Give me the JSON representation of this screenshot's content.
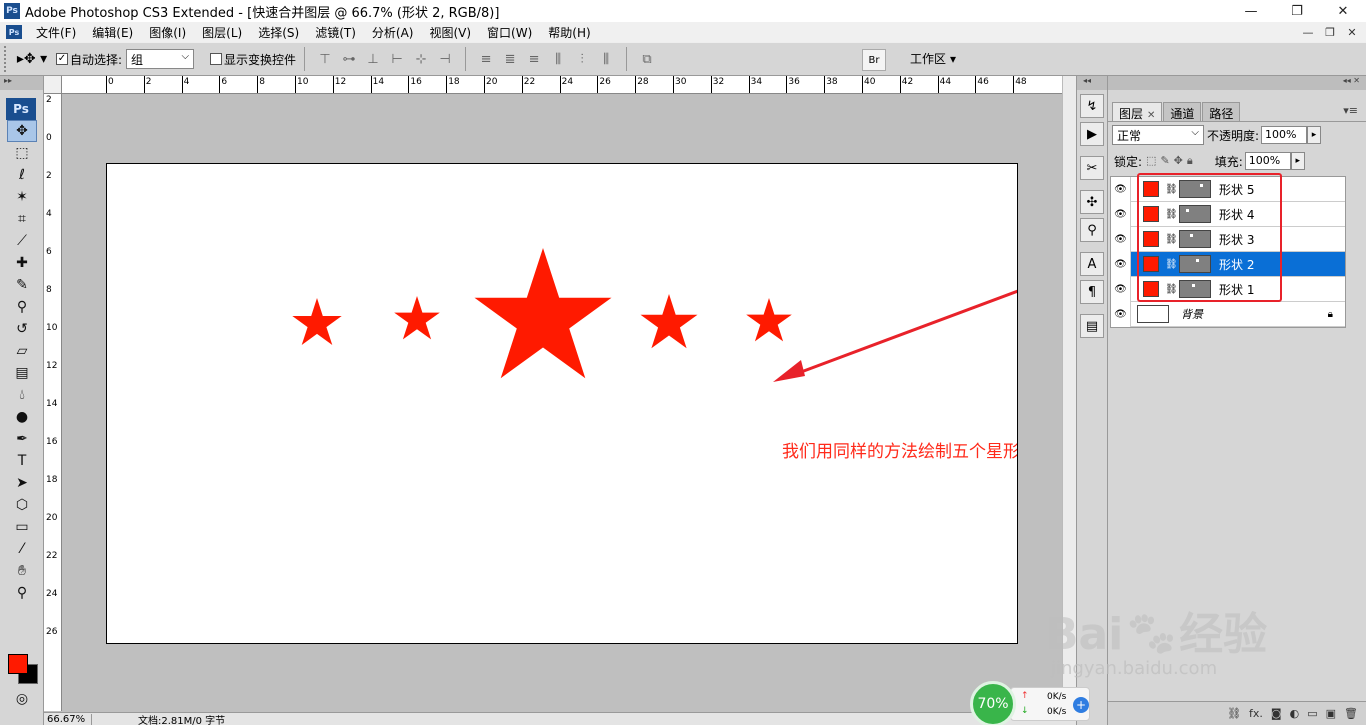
{
  "window": {
    "title": "Adobe Photoshop CS3 Extended - [快速合并图层 @ 66.7% (形状 2, RGB/8)]",
    "app_icon": "Ps",
    "controls": [
      "—",
      "❐",
      "✕"
    ]
  },
  "menu": {
    "items": [
      "文件(F)",
      "编辑(E)",
      "图像(I)",
      "图层(L)",
      "选择(S)",
      "滤镜(T)",
      "分析(A)",
      "视图(V)",
      "窗口(W)",
      "帮助(H)"
    ],
    "doc_controls": [
      "—",
      "❐",
      "✕"
    ]
  },
  "options": {
    "auto_select_label": "自动选择:",
    "auto_select_value": "组",
    "show_transform_label": "显示变换控件",
    "workspace_label": "工作区",
    "bridge_label": "Br"
  },
  "toolbox": {
    "badge": "Ps",
    "tools": [
      "move-tool",
      "marquee-tool",
      "lasso-tool",
      "magic-wand-tool",
      "crop-tool",
      "slice-tool",
      "healing-brush-tool",
      "brush-tool",
      "clone-stamp-tool",
      "history-brush-tool",
      "eraser-tool",
      "gradient-tool",
      "blur-tool",
      "dodge-tool",
      "pen-tool",
      "type-tool",
      "path-select-tool",
      "shape-tool",
      "notes-tool",
      "eyedropper-tool",
      "hand-tool",
      "zoom-tool"
    ],
    "fg_color": "#ff1a00",
    "bg_color": "#000000"
  },
  "rulers": {
    "h": [
      "0",
      "2",
      "4",
      "6",
      "8",
      "10",
      "12",
      "14",
      "16",
      "18",
      "20",
      "22",
      "24",
      "26",
      "28",
      "30",
      "32",
      "34",
      "36",
      "38",
      "40",
      "42",
      "44",
      "46",
      "48"
    ],
    "v": [
      "2",
      "0",
      "2",
      "4",
      "6",
      "8",
      "10",
      "12",
      "14",
      "16",
      "18",
      "20",
      "22",
      "24",
      "26"
    ]
  },
  "canvas": {
    "star_color": "#ff1a00",
    "star_count": 5,
    "annotation": "我们用同样的方法绘制五个星形",
    "annotation_color": "#ff2a1a"
  },
  "status": {
    "zoom": "66.67%",
    "doc_info": "文档:2.81M/0 字节"
  },
  "layers_panel": {
    "tabs": [
      "图层",
      "通道",
      "路径"
    ],
    "blend_mode": "正常",
    "opacity_label": "不透明度:",
    "opacity": "100%",
    "lock_label": "锁定:",
    "fill_label": "填充:",
    "fill": "100%",
    "layers": [
      {
        "name": "形状 5",
        "selected": false
      },
      {
        "name": "形状 4",
        "selected": false
      },
      {
        "name": "形状 3",
        "selected": false
      },
      {
        "name": "形状 2",
        "selected": true
      },
      {
        "name": "形状 1",
        "selected": false
      }
    ],
    "background_layer": "背景",
    "shape_color": "#ff1a00",
    "selected_color": "#0a6fd6"
  },
  "net_widget": {
    "percent": "70%",
    "up": "0K/s",
    "down": "0K/s"
  },
  "watermark": {
    "brand": "Bai",
    "brand2": "经验",
    "url": "jingyan.baidu.com"
  }
}
